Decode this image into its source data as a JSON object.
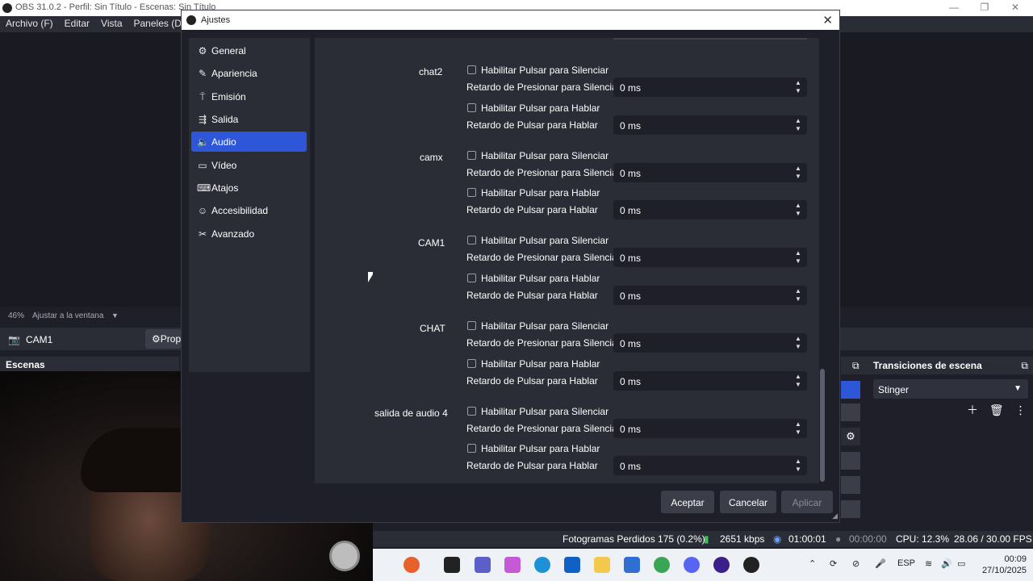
{
  "obs": {
    "title": "OBS 31.0.2 - Perfil: Sin Título - Escenas: Sin Título",
    "menu": [
      "Archivo (F)",
      "Editar",
      "Vista",
      "Paneles (D)"
    ],
    "zoom_value": "46%",
    "zoom_label": "Ajustar a la ventana",
    "source_name": "CAM1",
    "properties_label": "Prop",
    "scenes_title": "Escenas",
    "transitions_title": "Transiciones de escena",
    "transition_selected": "Stinger",
    "status": {
      "dropped_frames": "Fotogramas Perdidos 175 (0.2%)",
      "bitrate": "2651 kbps",
      "stream_time": "01:00:01",
      "rec_time": "00:00:00",
      "cpu": "CPU: 12.3%",
      "fps": "28.06 / 30.00 FPS"
    }
  },
  "dialog": {
    "title": "Ajustes",
    "nav": [
      {
        "label": "General",
        "icon": "gear-icon"
      },
      {
        "label": "Apariencia",
        "icon": "brush-icon"
      },
      {
        "label": "Emisión",
        "icon": "antenna-icon"
      },
      {
        "label": "Salida",
        "icon": "output-icon"
      },
      {
        "label": "Audio",
        "icon": "speaker-icon",
        "active": true
      },
      {
        "label": "Vídeo",
        "icon": "monitor-icon"
      },
      {
        "label": "Atajos",
        "icon": "keyboard-icon"
      },
      {
        "label": "Accesibilidad",
        "icon": "accessibility-icon"
      },
      {
        "label": "Avanzado",
        "icon": "tools-icon"
      }
    ],
    "sources": [
      {
        "name": "chat2"
      },
      {
        "name": "camx"
      },
      {
        "name": "CAM1"
      },
      {
        "name": "CHAT"
      },
      {
        "name": "salida de audio 4"
      }
    ],
    "push_to_mute_label": "Habilitar Pulsar para Silenciar",
    "push_to_mute_delay_label": "Retardo de Presionar para Silenciar",
    "push_to_talk_label": "Habilitar Pulsar para Hablar",
    "push_to_talk_delay_label": "Retardo de Pulsar para Hablar",
    "delay_value": "0 ms",
    "buttons": {
      "accept": "Aceptar",
      "cancel": "Cancelar",
      "apply": "Aplicar"
    }
  },
  "taskbar": {
    "lang": "ESP",
    "time": "00:09",
    "date": "27/10/2025"
  }
}
